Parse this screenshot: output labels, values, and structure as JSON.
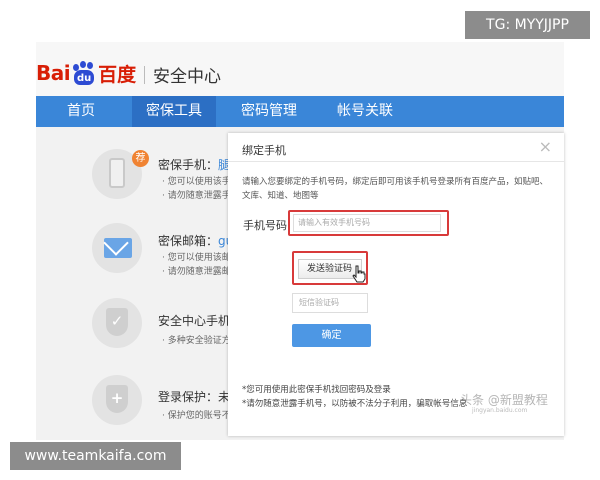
{
  "watermarks": {
    "top_right": "TG: MYYJJPP",
    "bottom_left": "www.teamkaifa.com",
    "center": "头条 @新盟教程",
    "center_sub": "jingyan.baidu.com"
  },
  "header": {
    "logo_bai": "Bai",
    "logo_du": "du",
    "logo_cn": "百度",
    "subtitle": "安全中心"
  },
  "nav": {
    "home": "首页",
    "mibao": "密保工具",
    "password": "密码管理",
    "account": "帐号关联"
  },
  "features": [
    {
      "title": "密保手机：",
      "title_value": "腿",
      "badge": "荐",
      "desc1": "· 您可以使用该手",
      "desc2": "· 请勿随意泄露手"
    },
    {
      "title": "密保邮箱：",
      "title_value": "gu.",
      "desc1": "· 您可以使用该邮",
      "desc2": "· 请勿随意泄露邮"
    },
    {
      "title": "安全中心手机版",
      "desc1": "· 多种安全验证方"
    },
    {
      "title": "登录保护：未开",
      "desc1": "· 保护您的账号不"
    }
  ],
  "dialog": {
    "title": "绑定手机",
    "close": "×",
    "intro": "请输入您要绑定的手机号码，绑定后即可用该手机号登录所有百度产品，如贴吧、文库、知道、地图等",
    "phone_label": "手机号码",
    "phone_placeholder": "请输入有效手机号码",
    "send_code_label": "发送验证码",
    "code_placeholder": "短信验证码",
    "confirm_label": "确定",
    "note1": "*您可用使用此密保手机找回密码及登录",
    "note2": "*请勿随意泄露手机号，以防被不法分子利用，骗取帐号信息"
  },
  "colors": {
    "nav_bg": "#3a86d8",
    "nav_active": "#2c6fc4",
    "brand_red": "#d81e06",
    "brand_blue": "#2d4bd3",
    "highlight_border": "#d83a3a",
    "confirm_bg": "#4d97e4",
    "badge": "#f08332"
  },
  "icons": [
    "phone-icon",
    "mail-icon",
    "shield-check-icon",
    "shield-plus-icon",
    "close-icon",
    "hand-cursor-icon"
  ]
}
